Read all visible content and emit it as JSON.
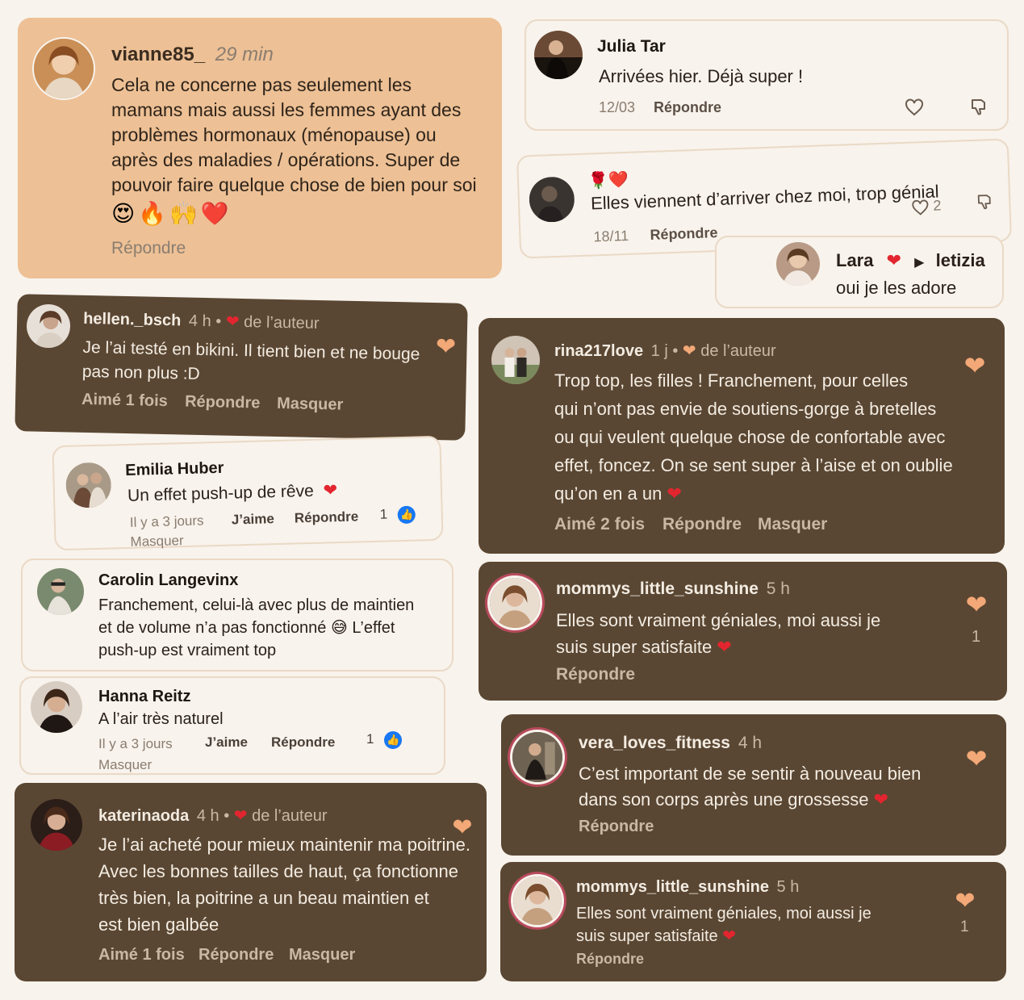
{
  "comments": [
    {
      "user": "vianne85_",
      "time": "29 min",
      "lines": [
        "Cela ne concerne pas seulement les",
        "mamans mais aussi les femmes ayant des",
        "problèmes hormonaux (ménopause) ou",
        "après des maladies / opérations. Super de",
        "pouvoir faire quelque chose de bien pour soi"
      ],
      "emojis": "😍🔥🙌❤️",
      "reply": "Répondre"
    },
    {
      "user": "Julia Tar",
      "text": "Arrivées hier. Déjà super !",
      "date": "12/03",
      "reply": "Répondre"
    },
    {
      "emojis": "🌹❤️",
      "text": "Elles viennent d’arriver chez moi, trop génial",
      "date": "18/11",
      "reply": "Répondre",
      "likes": "2"
    },
    {
      "user": "Lara",
      "to": "letizia",
      "text": "oui je les adore"
    },
    {
      "user": "hellen._bsch",
      "time": "4 h",
      "author_tag": "de l’auteur",
      "lines": [
        "Je l’ai testé en bikini. Il tient bien et ne bouge",
        "pas non plus :D"
      ],
      "liked": "Aimé 1 fois",
      "reply": "Répondre",
      "hide": "Masquer"
    },
    {
      "user": "Emilia Huber",
      "text": "Un effet push-up de rêve",
      "time": "Il y a 3 jours",
      "like": "J’aime",
      "reply": "Répondre",
      "likes": "1",
      "hide": "Masquer"
    },
    {
      "user": "Carolin Langevinx",
      "lines": [
        "Franchement, celui-là avec plus de maintien",
        "et de volume n’a pas fonctionné",
        "push-up est vraiment top"
      ],
      "line2_end": "L’effet"
    },
    {
      "user": "Hanna Reitz",
      "text": "A l’air très naturel",
      "time": "Il y a 3 jours",
      "like": "J’aime",
      "reply": "Répondre",
      "likes": "1",
      "hide": "Masquer"
    },
    {
      "user": "katerinaoda",
      "time": "4 h",
      "author_tag": "de l’auteur",
      "lines": [
        "Je l’ai acheté pour mieux maintenir ma poitrine.",
        "Avec les bonnes tailles de haut, ça fonctionne",
        "très bien, la poitrine a un beau maintien et",
        "est bien galbée"
      ],
      "liked": "Aimé 1 fois",
      "reply": "Répondre",
      "hide": "Masquer"
    },
    {
      "user": "rina217love",
      "time": "1 j",
      "author_tag": "de l’auteur",
      "lines": [
        "Trop top, les filles ! Franchement, pour celles",
        "qui n’ont pas envie de soutiens-gorge à bretelles",
        "ou qui veulent quelque chose de confortable avec",
        "effet, foncez. On se sent super à l’aise et on oublie",
        "qu’on en a un"
      ],
      "liked": "Aimé 2 fois",
      "reply": "Répondre",
      "hide": "Masquer"
    },
    {
      "user": "mommys_little_sunshine",
      "time": "5 h",
      "lines": [
        "Elles sont vraiment géniales, moi aussi je",
        "suis super satisfaite"
      ],
      "reply": "Répondre",
      "likes": "1"
    },
    {
      "user": "vera_loves_fitness",
      "time": "4 h",
      "lines": [
        "C’est important de se sentir à nouveau bien",
        "dans son corps après une grossesse"
      ],
      "reply": "Répondre"
    },
    {
      "user": "mommys_little_sunshine",
      "time": "5 h",
      "lines": [
        "Elles sont vraiment géniales, moi aussi je",
        "suis super satisfaite"
      ],
      "reply": "Répondre",
      "likes": "1"
    }
  ],
  "icons": {
    "heart": "heart-icon",
    "dislike": "thumbs-down-icon",
    "like_badge": "thumbs-up-badge-icon",
    "arrow": "play-arrow-icon"
  },
  "colors": {
    "tan_card": "#edc095",
    "dark_card": "#5a4733",
    "light_card": "#f8f3ec",
    "orange_heart": "#f3a877",
    "red_heart": "#e3252f",
    "facebook_blue": "#1877f2"
  }
}
